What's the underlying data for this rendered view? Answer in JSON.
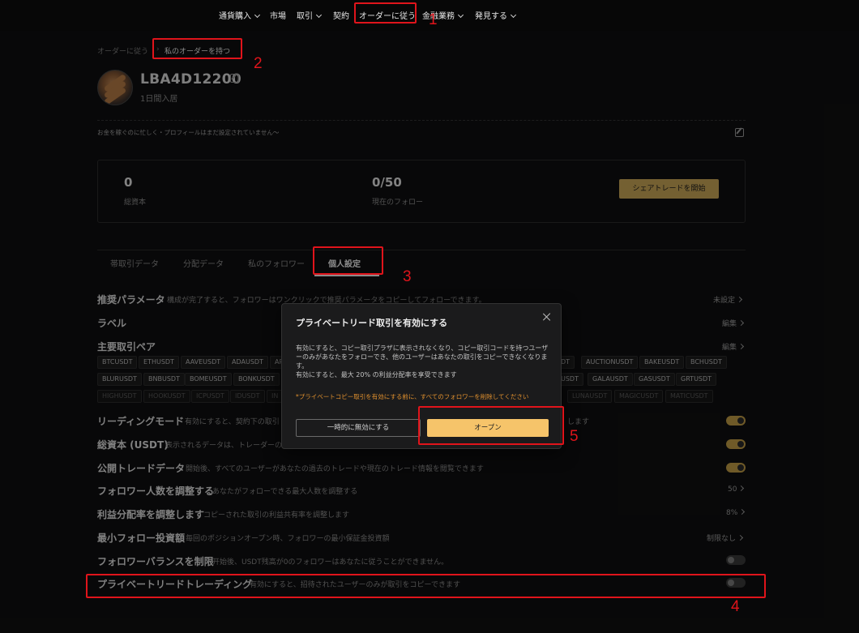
{
  "nav": {
    "currency": "通貨購入",
    "market": "市場",
    "trade": "取引",
    "contract": "契約",
    "copy": "オーダーに従う",
    "finance": "金融業務",
    "discover": "発見する"
  },
  "breadcrumb": {
    "parent": "オーダーに従う",
    "current": "私のオーダーを持つ"
  },
  "profile": {
    "name": "LBA4D12200",
    "joined": "1日間入居",
    "bio": "お金を稼ぐのに忙しく・プロフィールはまだ設定されていません〜"
  },
  "stats": {
    "capital_value": "0",
    "capital_label": "総資本",
    "followers_value": "0/50",
    "followers_label": "現在のフォロー",
    "share_button": "シェアトレードを開始"
  },
  "tabs": [
    "帯取引データ",
    "分配データ",
    "私のフォロワー",
    "個人設定"
  ],
  "settings": {
    "params": {
      "title": "推奨パラメータ",
      "desc": "構成が完了すると、フォロワーはワンクリックで推奨パラメータをコピーしてフォローできます。",
      "value": "未設定"
    },
    "label": {
      "title": "ラベル",
      "value": "編集"
    },
    "pairs": {
      "title": "主要取引ペア",
      "value": "編集",
      "row1": [
        "BTCUSDT",
        "ETHUSDT",
        "AAVEUSDT",
        "ADAUSDT",
        "AP",
        "DT",
        "AUCTIONUSDT",
        "BAKEUSDT",
        "BCHUSDT"
      ],
      "row2": [
        "BLURUSDT",
        "BNBUSDT",
        "BOMEUSDT",
        "BONKUSDT",
        "",
        "USDT",
        "GALAUSDT",
        "GASUSDT",
        "GRTUSDT"
      ],
      "row3": [
        "HIGHUSDT",
        "HOOKUSDT",
        "ICPUSDT",
        "IDUSDT",
        "IN",
        "LUNAUSDT",
        "MAGICUSDT",
        "MATICUSDT"
      ]
    },
    "leading": {
      "title": "リーディングモード",
      "desc": "有効にすると、契約下の取引",
      "desc_end": "します"
    },
    "capital": {
      "title": "総資本 (USDT)",
      "desc": "表示されるデータは、トレーダーの"
    },
    "public": {
      "title": "公開トレードデータ",
      "desc": "開始後、すべてのユーザーがあなたの過去のトレードや現在のトレード情報を閲覧できます"
    },
    "follower_count": {
      "title": "フォロワー人数を調整する",
      "desc": "あなたがフォローできる最大人数を調整する",
      "value": "50"
    },
    "profit_share": {
      "title": "利益分配率を調整します",
      "desc": "コピーされた取引の利益共有率を調整します",
      "value": "8%"
    },
    "min_invest": {
      "title": "最小フォロー投資額",
      "desc": "毎回のポジションオープン時、フォロワーの最小保証金投資額",
      "value": "制限なし"
    },
    "balance_limit": {
      "title": "フォロワーバランスを制限",
      "desc": "开始後、USDT残高が0のフォロワーはあなたに従うことができません。"
    },
    "private": {
      "title": "プライベートリードトレーディング",
      "desc": "有効にすると、招待されたユーザーのみが取引をコピーできます"
    }
  },
  "modal": {
    "title": "プライベートリード取引を有効にする",
    "body": "有効にすると、コピー取引プラザに表示されなくなり、コピー取引コードを持つユーザーのみがあなたをフォローでき、他のユーザーはあなたの取引をコピーできなくなります。",
    "body2": "有効にすると、最大 20% の利益分配率を享受できます",
    "warning": "*プライベートコピー取引を有効にする前に、すべてのフォロワーを削除してください",
    "cancel": "一時的に無効にする",
    "confirm": "オープン"
  },
  "annotations": [
    "1",
    "2",
    "3",
    "4",
    "5"
  ],
  "colors": {
    "accent": "#c9a557",
    "annotation": "#e0141b",
    "primary_button": "#f6c46a",
    "warning": "#e0902e"
  }
}
